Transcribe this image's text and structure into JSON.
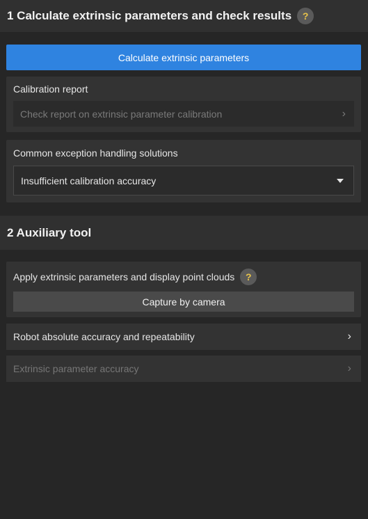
{
  "section1": {
    "title": "1 Calculate extrinsic parameters and check results",
    "help_icon": "?",
    "calculate_button": "Calculate extrinsic parameters",
    "calibration_report": {
      "title": "Calibration report",
      "link_label": "Check report on extrinsic parameter calibration"
    },
    "exception_handling": {
      "title": "Common exception handling solutions",
      "selected": "Insufficient calibration accuracy"
    }
  },
  "section2": {
    "title": "2 Auxiliary tool",
    "apply_card": {
      "title": "Apply extrinsic parameters and display point clouds",
      "help_icon": "?",
      "capture_button": "Capture by camera"
    },
    "robot_accuracy_label": "Robot absolute accuracy and repeatability",
    "extrinsic_accuracy_label": "Extrinsic parameter accuracy"
  },
  "colors": {
    "accent": "#2f83e0",
    "help_icon": "#e8c34a",
    "background": "#262626"
  }
}
